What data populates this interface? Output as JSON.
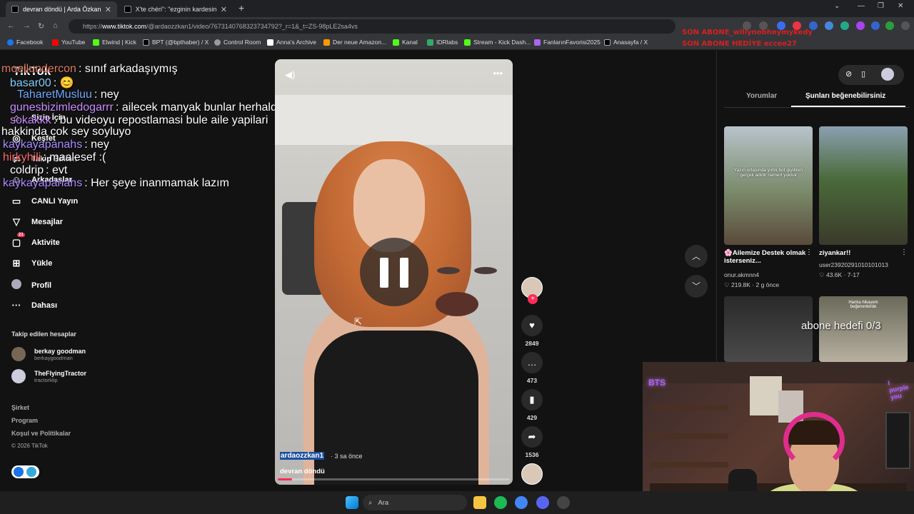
{
  "tabs": [
    {
      "label": "devran döndü | Arda Özkan",
      "active": true
    },
    {
      "label": "X'te chéri\": \"ezginin kardesinin ig",
      "active": false
    }
  ],
  "address": {
    "prefix": "https://",
    "host": "www.tiktok.com",
    "path": "/@ardaozzkan1/video/7673140768323734792?_r=1&_t=ZS-98pLE2sa4vs"
  },
  "bookmarks": [
    "Facebook",
    "YouTube",
    "Elwind | Kick",
    "BPT (@bpthaber) / X",
    "Control Room",
    "Anna's Archive",
    "Der neue Amazon...",
    "Kanal",
    "IDRlabs",
    "Stream - Kick Dash...",
    "FanlarınFavorisi2025",
    "Anasayfa / X"
  ],
  "overlay": {
    "line1": "SON ABONE_willynobheymykedy",
    "line2": "SON ABONE HEDİYE eccee27"
  },
  "sidebar": {
    "logo": "TikTok",
    "items": [
      "Sizin İçin",
      "Keşfet",
      "Takip Edilen",
      "Arkadaşlar",
      "CANLI Yayın",
      "Mesajlar",
      "Aktivite",
      "Yükle",
      "Profil",
      "Dahası"
    ],
    "activity_badge": "21",
    "following_title": "Takip edilen hesaplar",
    "following": [
      {
        "name": "berkay goodman",
        "handle": "berkaygoodman"
      },
      {
        "name": "TheFlyingTractor",
        "handle": "tractorklip"
      }
    ],
    "footer": [
      "Şirket",
      "Program",
      "Koşul ve Politikalar"
    ],
    "copyright": "© 2026 TikTok"
  },
  "chat": [
    {
      "user": "moellundercon",
      "msg": ": sınıf arkadaşıymış",
      "color": "#e07a5f"
    },
    {
      "user": "basar00",
      "msg": ": 😊",
      "color": "#7fd0ff"
    },
    {
      "user": "TaharetMusluu",
      "msg": ": ney",
      "color": "#6fa8ff"
    },
    {
      "user": "gunesbizimledogarrr",
      "msg": ": ailecek manyak bunlar herhalde",
      "color": "#c98bff"
    },
    {
      "user": "sokakkk",
      "msg": ": bu videoyu repostlamasi bule aile yapilari",
      "color": "#c98bff"
    },
    {
      "user": "",
      "msg": "hakkinda cok sey soyluyo",
      "color": "#ffffff"
    },
    {
      "user": "kaykayapanahs",
      "msg": ": ney",
      "color": "#a98bff"
    },
    {
      "user": "hirkyhili",
      "msg": ": maalesef :(",
      "color": "#ff6b6b"
    },
    {
      "user": "coldrip",
      "msg": ": evt",
      "color": "#ffffff"
    },
    {
      "user": "kaykayapanahs",
      "msg": ": Her şeye inanmamak lazım",
      "color": "#a98bff"
    }
  ],
  "video": {
    "author": "ardaozzkan1",
    "time": "· 3 sa önce",
    "caption": "devran döndü",
    "progress": 0.06
  },
  "actions": {
    "likes": "2849",
    "comments": "473",
    "saves": "429",
    "shares": "1536"
  },
  "right_panel": {
    "tabs": [
      "Yorumlar",
      "Şunları beğenebilirsiniz"
    ],
    "videos": [
      {
        "title": "🌸Ailemize Destek olmak isterseniz...",
        "user": "onur.akmnn4",
        "likes": "219.8K",
        "when": "2 g önce",
        "caption": "Yazın ortasında yırtık bot giydiren gerçek adidir namert yokluk"
      },
      {
        "title": "ziyankar!!",
        "user": "user23920291010101013",
        "likes": "43.6K",
        "when": "7-17",
        "caption": ""
      },
      {
        "title": "",
        "user": "",
        "likes": "",
        "when": "",
        "caption": ""
      },
      {
        "title": "",
        "user": "",
        "likes": "",
        "when": "",
        "caption": "Hanka hikayem beğenenlerde"
      }
    ]
  },
  "stream_overlay": {
    "goal": "abone hedefi 0/3",
    "neon": "I purple you",
    "bts": "BTS"
  },
  "taskbar": {
    "search": "Ara"
  }
}
